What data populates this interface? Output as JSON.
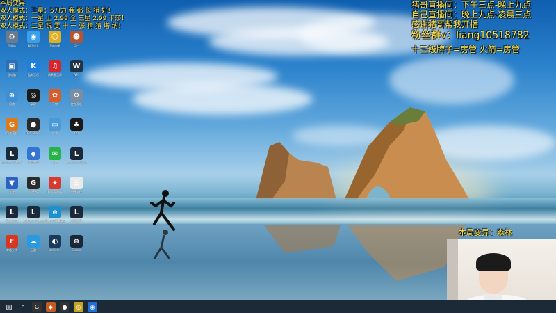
{
  "overlay_left": {
    "line1": "本局变异",
    "line2": "双人模式：三星：5刀力 我 都 长 猎 好！",
    "line3": "双人模式：一星 上 2.99 全 三星 2.99 卡莎！",
    "line4": "双人模式：二星 锐 雯 十 一 张 猜 猜 塔 纳！"
  },
  "overlay_right": {
    "line1": "猪哥直播间：下午三点-晚上九点",
    "line2": "自己直播间：晚上九点-凌晨三点",
    "line3": "感谢猪哥帮我开播",
    "line4": "粉丝群v：liang10518782",
    "line5": "十三级牌子=房管 火箭=房管"
  },
  "mutation": "本局变异：森林",
  "desktop_icons": [
    {
      "name": "recycle-bin",
      "label": "回收站",
      "color": "#6a7b8c",
      "glyph": "♻"
    },
    {
      "name": "qq-music",
      "label": "腾讯课堂",
      "color": "#3aa0e8",
      "glyph": "◉"
    },
    {
      "name": "cat-app",
      "label": "我的电脑",
      "color": "#e0b020",
      "glyph": "☺"
    },
    {
      "name": "person-app",
      "label": "用户",
      "color": "#b5542f",
      "glyph": "☻"
    },
    {
      "name": "computer",
      "label": "此电脑",
      "color": "#2d6fb5",
      "glyph": "▣"
    },
    {
      "name": "kugou",
      "label": "酷狗音乐",
      "color": "#1e7fe0",
      "glyph": "K"
    },
    {
      "name": "netease",
      "label": "网易云音乐",
      "color": "#d8262f",
      "glyph": "♫"
    },
    {
      "name": "wps",
      "label": "WPS",
      "color": "#223344",
      "glyph": "W"
    },
    {
      "name": "network",
      "label": "网络",
      "color": "#3d8fd6",
      "glyph": "⊕"
    },
    {
      "name": "obs-tool",
      "label": "录屏",
      "color": "#1b1b1b",
      "glyph": "◎"
    },
    {
      "name": "animal-app",
      "label": "宠物",
      "color": "#d95c2b",
      "glyph": "✿"
    },
    {
      "name": "control-panel",
      "label": "控制面板",
      "color": "#7a8ea3",
      "glyph": "⚙"
    },
    {
      "name": "g-app",
      "label": "G-加速器",
      "color": "#e07a18",
      "glyph": "G"
    },
    {
      "name": "obs-studio",
      "label": "OBS Studio",
      "color": "#2a2a2a",
      "glyph": "●"
    },
    {
      "name": "screen-app",
      "label": "屏幕",
      "color": "#4a9ad8",
      "glyph": "▭"
    },
    {
      "name": "qq",
      "label": "QQ",
      "color": "#1a1a1a",
      "glyph": "♣"
    },
    {
      "name": "lol",
      "label": "League of Legends",
      "color": "#1a2a3a",
      "glyph": "L"
    },
    {
      "name": "box-app",
      "label": "应用商店",
      "color": "#3475d1",
      "glyph": "◆"
    },
    {
      "name": "wechat",
      "label": "微信",
      "color": "#26b34a",
      "glyph": "✉"
    },
    {
      "name": "lol2",
      "label": "League of Legends",
      "color": "#1a2a3a",
      "glyph": "L"
    },
    {
      "name": "installer",
      "label": "安装",
      "color": "#2e62c2",
      "glyph": "▼"
    },
    {
      "name": "g-tool",
      "label": "加速器",
      "color": "#2a2a2a",
      "glyph": "G"
    },
    {
      "name": "red-app",
      "label": "Riot Client",
      "color": "#d83a2e",
      "glyph": "✦"
    },
    {
      "name": "file",
      "label": "新建文件",
      "color": "#e9e9e9",
      "glyph": "▤"
    },
    {
      "name": "lol3",
      "label": "WeGame",
      "color": "#1a2a3a",
      "glyph": "L"
    },
    {
      "name": "lol4",
      "label": "League of Legends",
      "color": "#1a2a3a",
      "glyph": "L"
    },
    {
      "name": "edge",
      "label": "Microsoft Edge",
      "color": "#1e8fcf",
      "glyph": "e"
    },
    {
      "name": "lol5",
      "label": "英雄联盟",
      "color": "#1a2a3a",
      "glyph": "L"
    },
    {
      "name": "cf",
      "label": "穿越火线",
      "color": "#d8361f",
      "glyph": "F"
    },
    {
      "name": "cloud-app",
      "label": "云盘",
      "color": "#2a9ae0",
      "glyph": "☁"
    },
    {
      "name": "steam-like",
      "label": "WeGame",
      "color": "#1a3a5a",
      "glyph": "◐"
    },
    {
      "name": "steam",
      "label": "Steam",
      "color": "#1b2838",
      "glyph": "⊛"
    }
  ],
  "taskbar": {
    "start_glyph": "⊞",
    "search_glyph": "⌕",
    "apps": [
      {
        "name": "g-task",
        "glyph": "G",
        "color": "#333"
      },
      {
        "name": "app-task",
        "glyph": "◆",
        "color": "#c75a1e"
      },
      {
        "name": "obs-task",
        "glyph": "●",
        "color": "#333"
      },
      {
        "name": "yellow-task",
        "glyph": "◎",
        "color": "#c7a41e"
      },
      {
        "name": "browser-task",
        "glyph": "◉",
        "color": "#1f6fd6"
      }
    ]
  }
}
